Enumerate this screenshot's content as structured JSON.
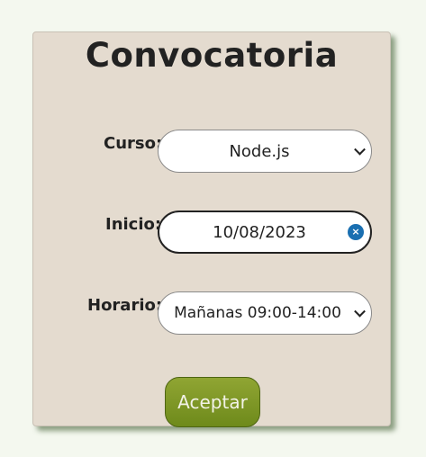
{
  "form": {
    "title": "Convocatoria",
    "fields": {
      "curso": {
        "label": "Curso:",
        "value": "Node.js"
      },
      "inicio": {
        "label": "Inicio:",
        "value": "10/08/2023",
        "clear_icon": "×"
      },
      "horario": {
        "label": "Horario:",
        "value": "Mañanas 09:00-14:00"
      }
    },
    "submit_label": "Aceptar"
  },
  "colors": {
    "card_background": "#e4dbcf",
    "button_green": "#7f991f",
    "clear_icon_blue": "#1a6fb1"
  }
}
